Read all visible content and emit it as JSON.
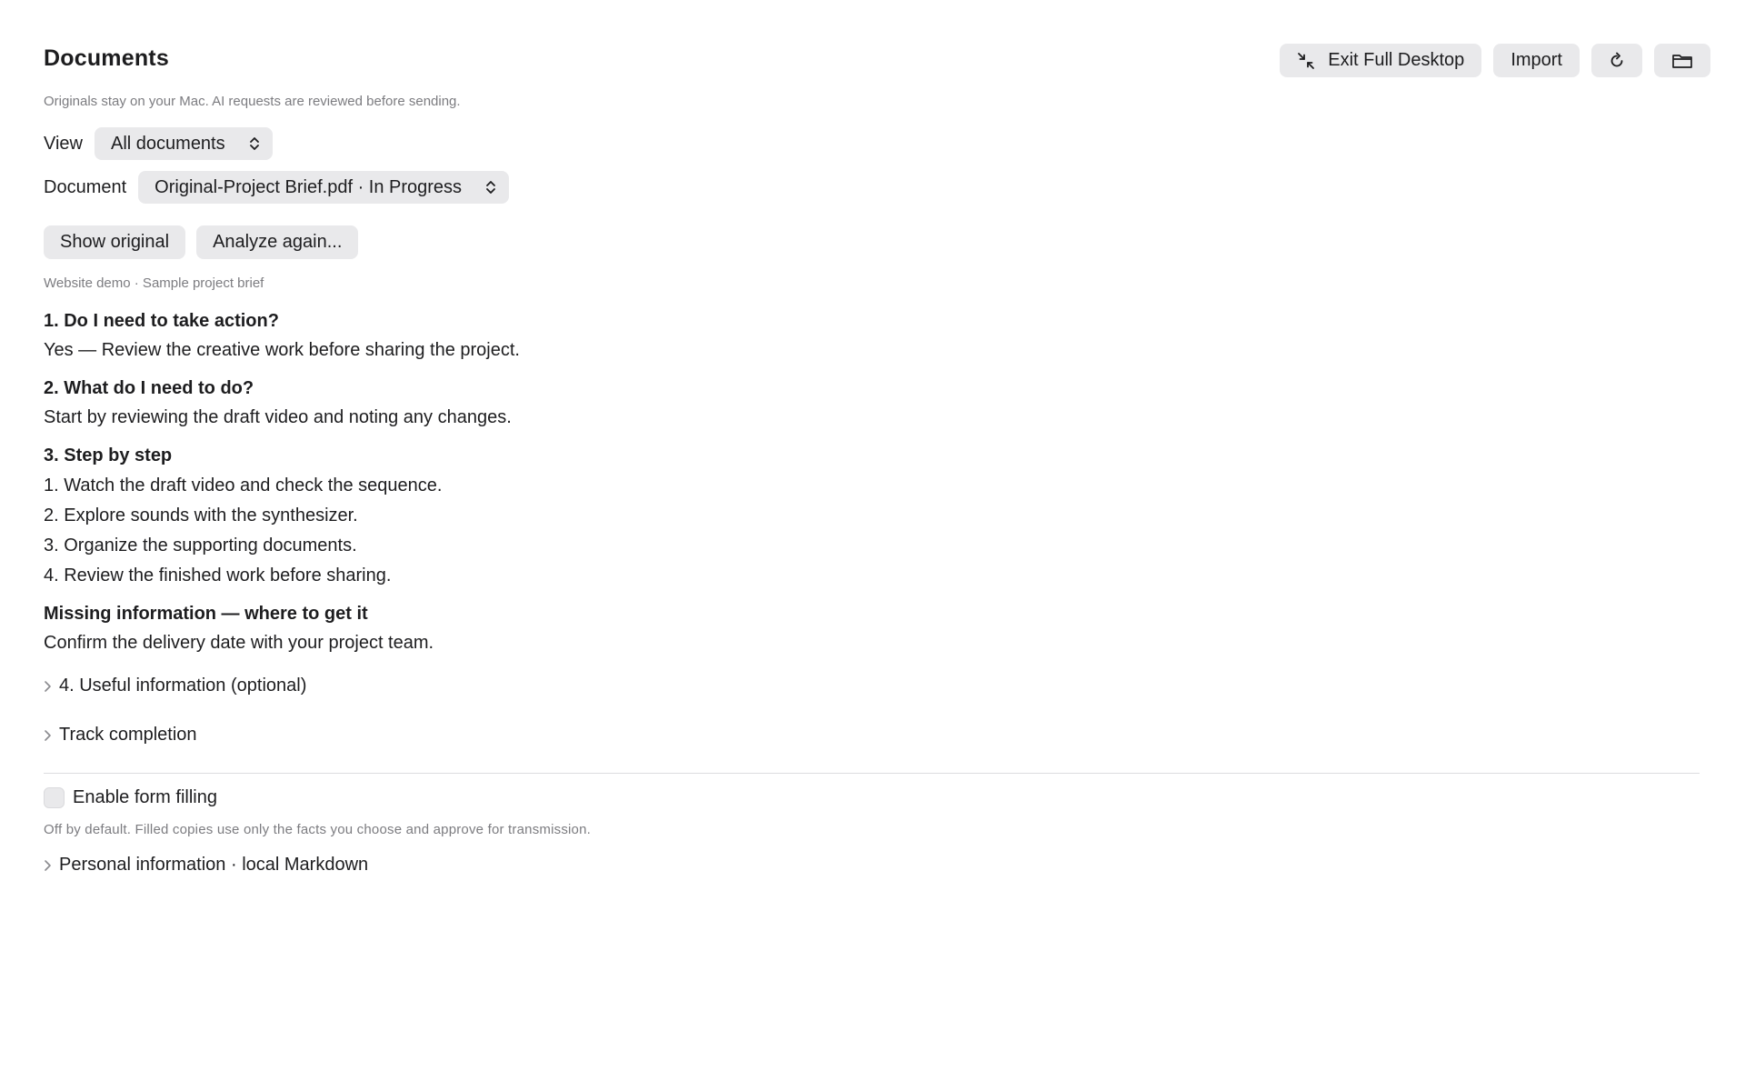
{
  "header": {
    "title": "Documents",
    "subtitle": "Originals stay on your Mac. AI requests are reviewed before sending."
  },
  "toolbar": {
    "exit_full_desktop_label": "Exit Full Desktop",
    "import_label": "Import",
    "refresh_icon": "refresh-icon",
    "folder_icon": "folder-icon"
  },
  "view": {
    "label": "View",
    "selected": "All documents"
  },
  "document": {
    "label": "Document",
    "selected": "Original-Project Brief.pdf · In Progress"
  },
  "actions": {
    "show_original_label": "Show original",
    "analyze_again_label": "Analyze again..."
  },
  "meta": "Website demo · Sample project brief",
  "analysis": {
    "q1": {
      "heading": "1. Do I need to take action?",
      "answer": "Yes — Review the creative work before sharing the project."
    },
    "q2": {
      "heading": "2. What do I need to do?",
      "answer": "Start by reviewing the draft video and noting any changes."
    },
    "q3": {
      "heading": "3. Step by step",
      "steps": [
        "1. Watch the draft video and check the sequence.",
        "2. Explore sounds with the synthesizer.",
        "3. Organize the supporting documents.",
        "4. Review the finished work before sharing."
      ]
    },
    "missing": {
      "heading": "Missing information — where to get it",
      "answer": "Confirm the delivery date with your project team."
    }
  },
  "disclosures": {
    "useful_info": "4. Useful information (optional)",
    "track_completion": "Track completion",
    "personal_info": "Personal information · local Markdown"
  },
  "form_filling": {
    "label": "Enable form filling",
    "checked": false,
    "note": "Off by default. Filled copies use only the facts you choose and approve for transmission."
  }
}
